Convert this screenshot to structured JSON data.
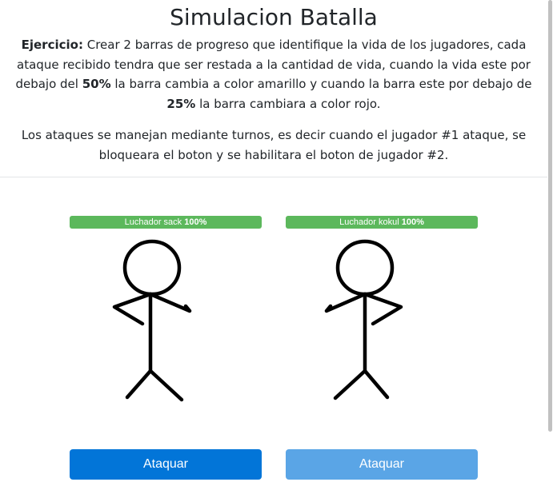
{
  "header": {
    "title": "Simulacion Batalla"
  },
  "description": {
    "label": "Ejercicio:",
    "text_1": " Crear 2 barras de progreso que identifique la vida de los jugadores, cada ataque recibido tendra que ser restada a la cantidad de vida, cuando la vida este por debajo del ",
    "threshold_yellow": "50%",
    "text_2": " la barra cambia a color amarillo y cuando la barra este por debajo de ",
    "threshold_red": "25%",
    "text_3": " la barra cambiara a color rojo.",
    "turns_text": "Los ataques se manejan mediante turnos, es decir cuando el jugador #1 ataque, se bloqueara el boton y se habilitara el boton de jugador #2."
  },
  "players": [
    {
      "name": "Luchador sack",
      "health_label": "100%",
      "health_fraction": 1.0,
      "bar_color": "#5cb85c",
      "attack_label": "Ataquar",
      "attack_enabled": true,
      "button_color": "#0275d8"
    },
    {
      "name": "Luchador kokul",
      "health_label": "100%",
      "health_fraction": 1.0,
      "bar_color": "#5cb85c",
      "attack_label": "Ataquar",
      "attack_enabled": false,
      "button_color": "#5aa5e6"
    }
  ]
}
